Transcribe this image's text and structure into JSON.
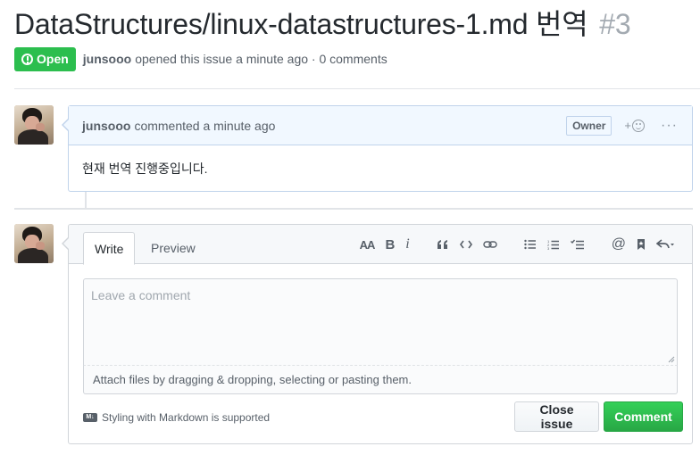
{
  "issue": {
    "title": "DataStructures/linux-datastructures-1.md 번역",
    "number": "#3",
    "state_label": "Open",
    "author": "junsooo",
    "meta_text": "opened this issue a minute ago · 0 comments"
  },
  "comment": {
    "author": "junsooo",
    "time_text": "commented a minute ago",
    "owner_badge": "Owner",
    "reaction_plus": "+",
    "more": "···",
    "body": "현재 번역 진행중입니다."
  },
  "editor": {
    "tabs": [
      {
        "label": "Write",
        "active": true
      },
      {
        "label": "Preview",
        "active": false
      }
    ],
    "toolbar": {
      "heading": "AA",
      "bold": "B",
      "italic": "i",
      "quote": "❝❞",
      "code": "<>"
    },
    "placeholder": "Leave a comment",
    "attach_hint": "Attach files by dragging & dropping, selecting or pasting them.",
    "markdown_note": "Styling with Markdown is supported",
    "markdown_icon_text": "M↓",
    "close_button": "Close issue",
    "comment_button": "Comment"
  },
  "colors": {
    "open_green": "#2cbe4e",
    "comment_header_bg": "#f1f8ff",
    "comment_border": "#c0d3eb",
    "button_green": "#28a745"
  },
  "icons": [
    "alert-icon",
    "smiley-icon",
    "kebab-icon",
    "heading-icon",
    "bold-icon",
    "italic-icon",
    "quote-icon",
    "code-icon",
    "link-icon",
    "unordered-list-icon",
    "ordered-list-icon",
    "task-list-icon",
    "mention-icon",
    "bookmark-icon",
    "reply-icon",
    "markdown-icon"
  ]
}
